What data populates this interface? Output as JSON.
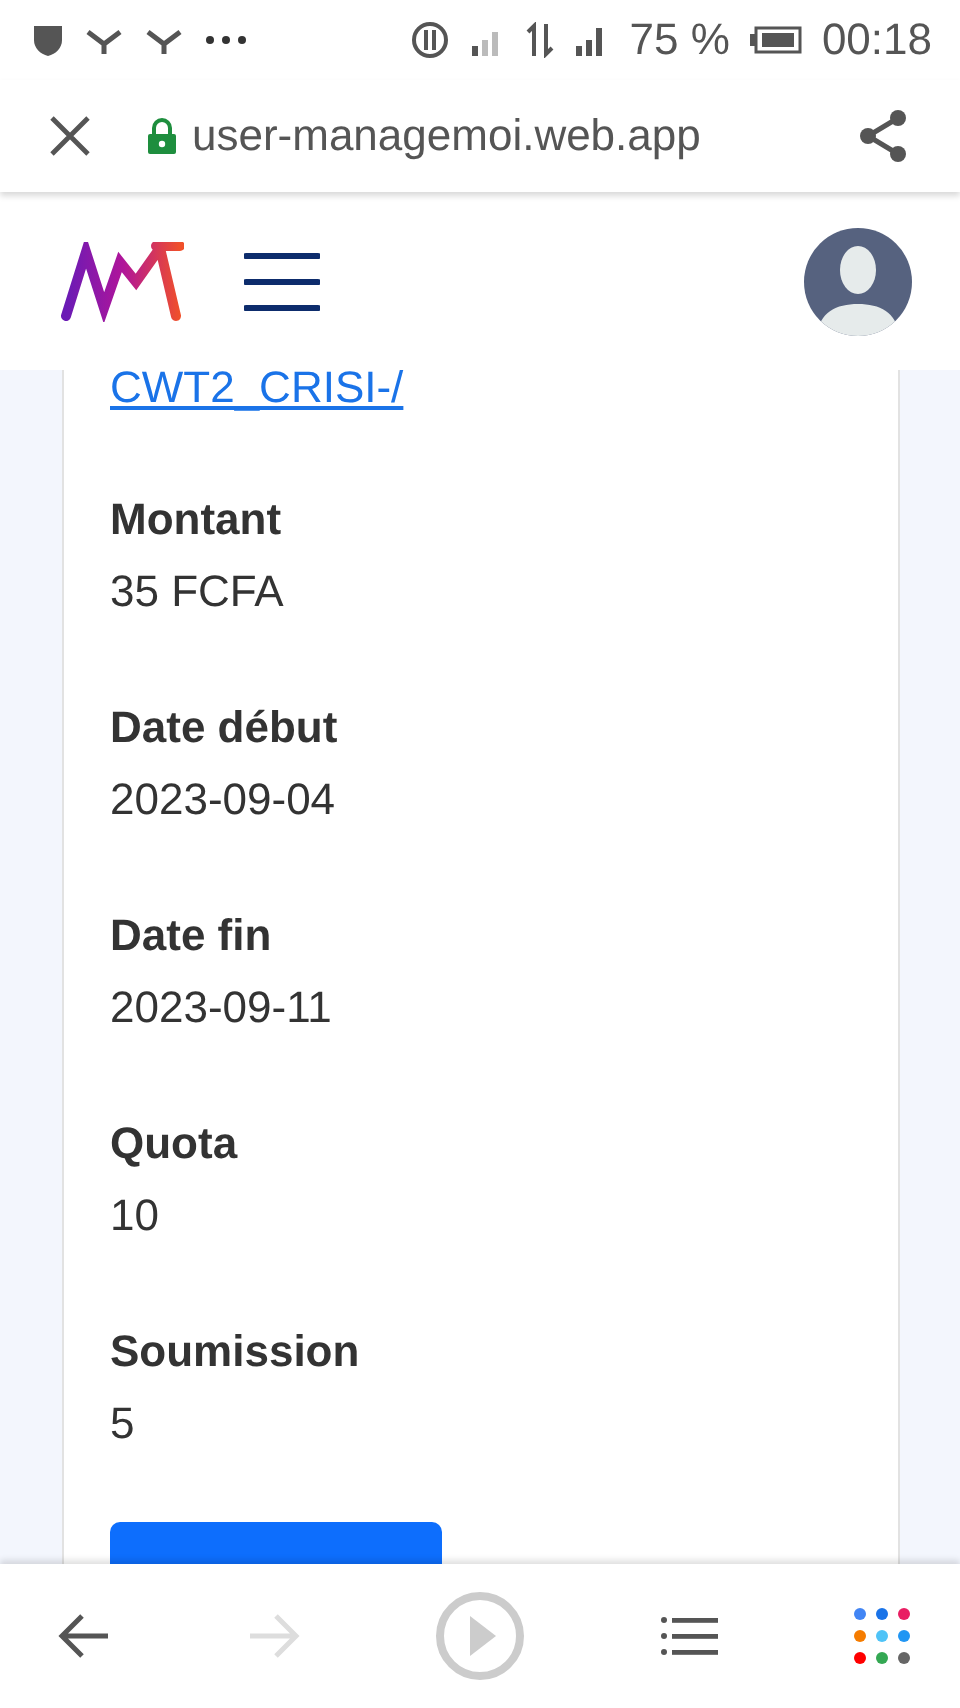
{
  "status_bar": {
    "battery": "75 %",
    "time": "00:18"
  },
  "browser_bar": {
    "url": "user-managemoi.web.app",
    "secure": true
  },
  "details": {
    "link": "CWT2_CRISI-/",
    "fields": [
      {
        "label": "Montant",
        "value": "35 FCFA"
      },
      {
        "label": "Date début",
        "value": "2023-09-04"
      },
      {
        "label": "Date fin",
        "value": "2023-09-11"
      },
      {
        "label": "Quota",
        "value": "10"
      },
      {
        "label": "Soumission",
        "value": "5"
      }
    ]
  },
  "nav_bar": [
    {
      "kind": "back",
      "disabled": false
    },
    {
      "kind": "forward",
      "disabled": true
    },
    {
      "kind": "play",
      "disabled": false
    },
    {
      "kind": "list",
      "disabled": false
    },
    {
      "kind": "apps",
      "disabled": false
    }
  ]
}
